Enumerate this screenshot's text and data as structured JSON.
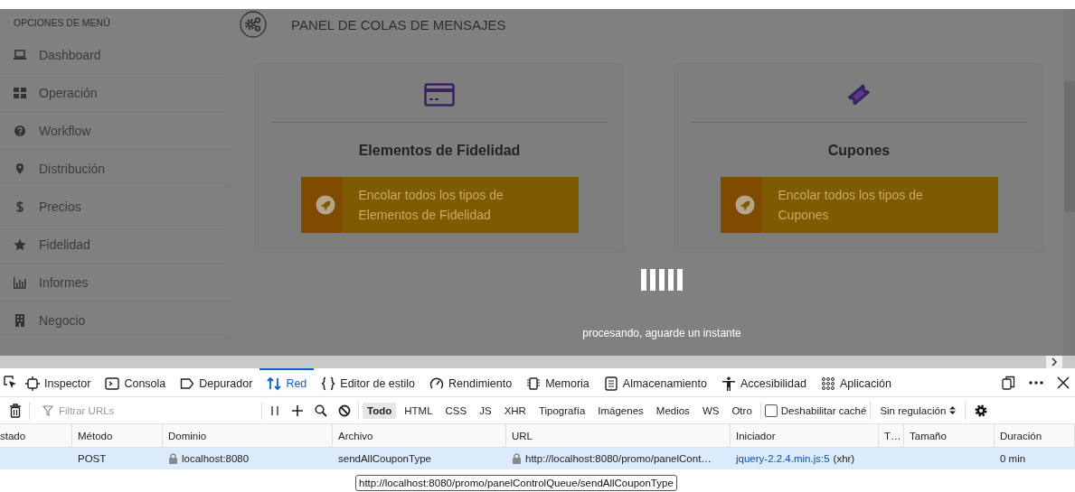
{
  "sidebar": {
    "heading": "OPCIONES DE MENÚ",
    "items": [
      {
        "label": "Dashboard"
      },
      {
        "label": "Operación"
      },
      {
        "label": "Workflow"
      },
      {
        "label": "Distribución"
      },
      {
        "label": "Precios"
      },
      {
        "label": "Fidelidad"
      },
      {
        "label": "Informes"
      },
      {
        "label": "Negocio"
      }
    ]
  },
  "page": {
    "title": "PANEL DE COLAS DE MENSAJES",
    "cards": [
      {
        "title": "Elementos de Fidelidad",
        "button": "Encolar todos los tipos de Elementos de Fidelidad"
      },
      {
        "title": "Cupones",
        "button": "Encolar todos los tipos de Cupones"
      }
    ]
  },
  "loading": {
    "message": "procesando, aguarde un instante"
  },
  "devtools": {
    "tabs": [
      {
        "label": "Inspector",
        "selected": false
      },
      {
        "label": "Consola",
        "selected": false
      },
      {
        "label": "Depurador",
        "selected": false
      },
      {
        "label": "Red",
        "selected": true
      },
      {
        "label": "Editor de estilo",
        "selected": false
      },
      {
        "label": "Rendimiento",
        "selected": false
      },
      {
        "label": "Memoria",
        "selected": false
      },
      {
        "label": "Almacenamiento",
        "selected": false
      },
      {
        "label": "Accesibilidad",
        "selected": false
      },
      {
        "label": "Aplicación",
        "selected": false
      }
    ],
    "filter": {
      "placeholder": "Filtrar URLs"
    },
    "type_filters": [
      {
        "label": "Todo",
        "selected": true
      },
      {
        "label": "HTML",
        "selected": false
      },
      {
        "label": "CSS",
        "selected": false
      },
      {
        "label": "JS",
        "selected": false
      },
      {
        "label": "XHR",
        "selected": false
      },
      {
        "label": "Tipografía",
        "selected": false
      },
      {
        "label": "Imágenes",
        "selected": false
      },
      {
        "label": "Medios",
        "selected": false
      },
      {
        "label": "WS",
        "selected": false
      },
      {
        "label": "Otro",
        "selected": false
      }
    ],
    "disable_cache": {
      "label": "Deshabilitar caché",
      "checked": false
    },
    "throttling": "Sin regulación",
    "columns": [
      "stado",
      "Método",
      "Dominio",
      "Archivo",
      "URL",
      "Iniciador",
      "T…",
      "Tamaño",
      "Duración"
    ],
    "rows": [
      {
        "selected": true,
        "method": "POST",
        "domain": "localhost:8080",
        "file": "sendAllCouponType",
        "url": "http://localhost:8080/promo/panelCont…",
        "initiator": "jquery-2.2.4.min.js:5",
        "initiator_type": "(xhr)",
        "duration": "0 min"
      }
    ],
    "tooltip": "http://localhost:8080/promo/panelControlQueue/sendAllCouponType"
  }
}
